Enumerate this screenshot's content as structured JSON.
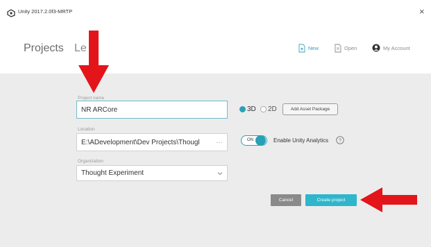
{
  "window": {
    "title": "Unity 2017.2.0f3-MRTP",
    "close_glyph": "×"
  },
  "header": {
    "tabs": [
      {
        "label": "Projects",
        "active": true
      },
      {
        "label": "Le",
        "active": false
      }
    ],
    "new_label": "New",
    "open_label": "Open",
    "account_label": "My Account"
  },
  "form": {
    "project_name_label": "Project name",
    "project_name_value": "NR ARCore",
    "location_label": "Location",
    "location_value": "E:\\ADevelopment\\Dev Projects\\Thougl",
    "location_browse": "···",
    "organization_label": "Organization",
    "organization_value": "Thought Experiment",
    "template_3d": "3D",
    "template_2d": "2D",
    "selected_template": "3D",
    "add_asset_label": "Add Asset Package",
    "analytics_toggle_label": "ON",
    "analytics_label": "Enable Unity Analytics",
    "help_glyph": "?"
  },
  "actions": {
    "cancel_label": "Cancel",
    "create_label": "Create project"
  },
  "colors": {
    "accent": "#2aa0b6",
    "annotation_red": "#e3151b",
    "panel_bg": "#ececec"
  },
  "icons": [
    "unity-logo-icon",
    "close-icon",
    "new-document-icon",
    "open-document-icon",
    "account-icon",
    "chevron-down-icon",
    "help-icon",
    "red-arrow-down-icon",
    "red-arrow-left-icon"
  ]
}
